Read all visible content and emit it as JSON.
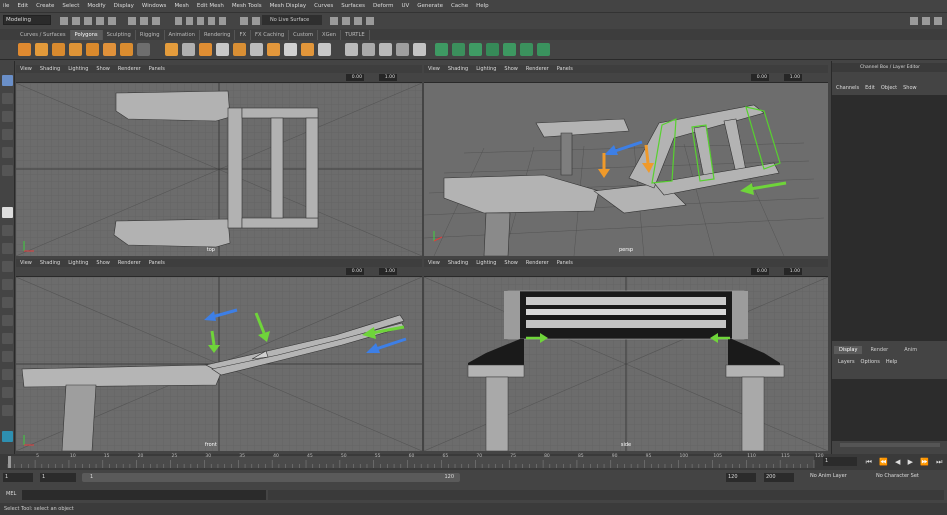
{
  "menubar": [
    "ile",
    "Edit",
    "Create",
    "Select",
    "Modify",
    "Display",
    "Windows",
    "Mesh",
    "Edit Mesh",
    "Mesh Tools",
    "Mesh Display",
    "Curves",
    "Surfaces",
    "Deform",
    "UV",
    "Generate",
    "Cache",
    "Help"
  ],
  "status": {
    "mode": "Modeling",
    "live_surface": "No Live Surface"
  },
  "shelf_tabs": [
    "Curves / Surfaces",
    "Polygons",
    "Sculpting",
    "Rigging",
    "Animation",
    "Rendering",
    "FX",
    "FX Caching",
    "Custom",
    "XGen",
    "TURTLE"
  ],
  "shelf_active": "Polygons",
  "viewport_menu": [
    "View",
    "Shading",
    "Lighting",
    "Show",
    "Renderer",
    "Panels"
  ],
  "viewports": {
    "top": {
      "label": "top",
      "near": "0.00",
      "far": "1.00"
    },
    "persp": {
      "label": "persp",
      "near": "0.00",
      "far": "1.00"
    },
    "front": {
      "label": "front",
      "near": "0.00",
      "far": "1.00"
    },
    "side": {
      "label": "side",
      "near": "0.00",
      "far": "1.00"
    }
  },
  "channel_box": {
    "title": "Channel Box / Layer Editor",
    "menu": [
      "Channels",
      "Edit",
      "Object",
      "Show"
    ]
  },
  "layer_editor": {
    "tabs": [
      "Display",
      "Render",
      "Anim"
    ],
    "active_tab": "Display",
    "menu": [
      "Layers",
      "Options",
      "Help"
    ]
  },
  "timeline": {
    "ticks": [
      "5",
      "10",
      "15",
      "20",
      "25",
      "30",
      "35",
      "40",
      "45",
      "50",
      "55",
      "60",
      "65",
      "70",
      "75",
      "80",
      "85",
      "90",
      "95",
      "100",
      "105",
      "110",
      "115",
      "120"
    ],
    "current_frame": "1"
  },
  "range": {
    "start": "1",
    "start2": "1",
    "slider_start": "1",
    "slider_end": "120",
    "end": "120",
    "end2": "200",
    "anim_layer": "No Anim Layer",
    "char_set": "No Character Set"
  },
  "mel": {
    "label": "MEL"
  },
  "help_line": "Select Tool: select an object",
  "colors": {
    "viewport_bg": "#6c6c6c",
    "ui_bg": "#444444",
    "arrow_green": "#6fd43a",
    "arrow_blue": "#3d7fe6",
    "arrow_orange": "#f09a2a",
    "selection_green": "#57d12f"
  }
}
